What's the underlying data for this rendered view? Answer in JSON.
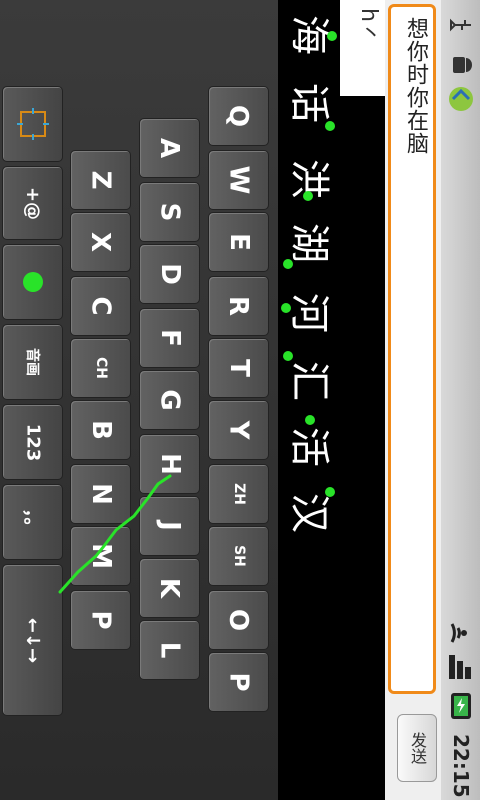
{
  "status_bar": {
    "time": "22:15",
    "icons": [
      "usb-icon",
      "android-debug-icon",
      "sync-icon",
      "wifi-icon",
      "signal-icon",
      "battery-charging-icon"
    ]
  },
  "compose": {
    "message_text": "想你时你在脑",
    "send_label": "发送"
  },
  "ime": {
    "pinyin": "h丶",
    "candidates": [
      "海",
      "话",
      "洪",
      "湖",
      "河",
      "汇",
      "活",
      "汉"
    ],
    "keys_row1": [
      "Q",
      "W",
      "E",
      "R",
      "T",
      "Y",
      "ZH",
      "SH",
      "O",
      "P"
    ],
    "keys_row2": [
      "A",
      "S",
      "D",
      "F",
      "G",
      "H",
      "J",
      "K",
      "L"
    ],
    "keys_row3": [
      "Z",
      "X",
      "C",
      "CH",
      "B",
      "N",
      "M",
      "P"
    ],
    "func_keys": [
      "+@",
      "音画",
      "123",
      "，。",
      "←↓→"
    ],
    "accent_color": "#29e329",
    "highlight_color": "#f08a19"
  }
}
